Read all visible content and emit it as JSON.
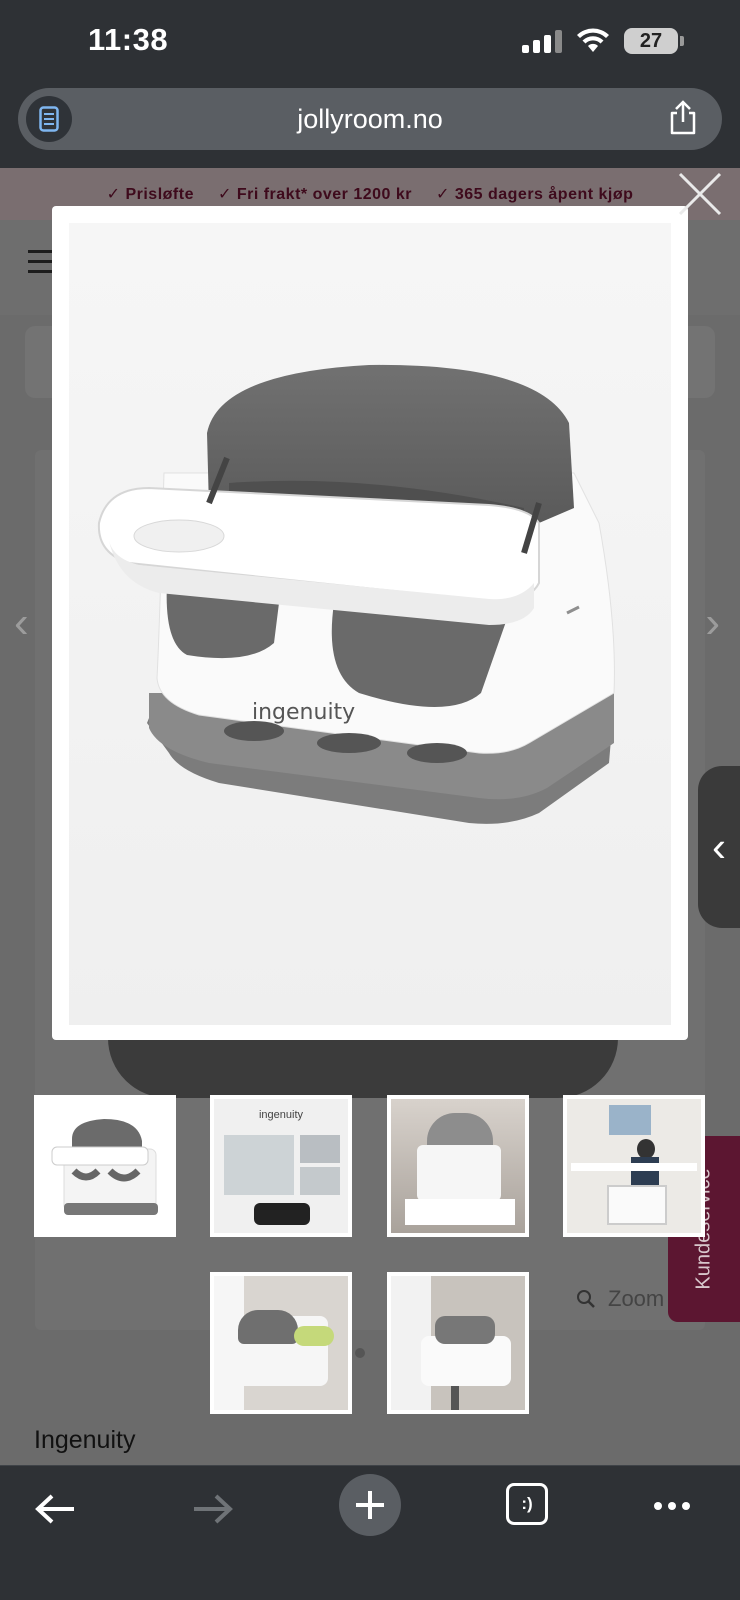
{
  "status_bar": {
    "time": "11:38",
    "battery": "27"
  },
  "browser": {
    "url": "jollyroom.no"
  },
  "page": {
    "promo_items": [
      "Prisløfte",
      "Fri frakt* over 1200 kr",
      "365 dagers åpent kjøp"
    ],
    "brand": "Ingenuity",
    "zoom_label": "Zoom",
    "kundeservice_label": "Kundeservice"
  },
  "modal": {
    "product_brand_logo": "ingenuity"
  },
  "thumbnails": {
    "items": [
      "thumb-1",
      "thumb-2",
      "thumb-3",
      "thumb-4",
      "thumb-5",
      "thumb-6"
    ],
    "box_logo": "ingenuity"
  },
  "toolbar": {
    "tabs_label": ":)"
  },
  "colors": {
    "promo_text": "#3e0a1c",
    "kundeservice_bg": "#5c1631",
    "chrome_bg": "#2e3135"
  }
}
